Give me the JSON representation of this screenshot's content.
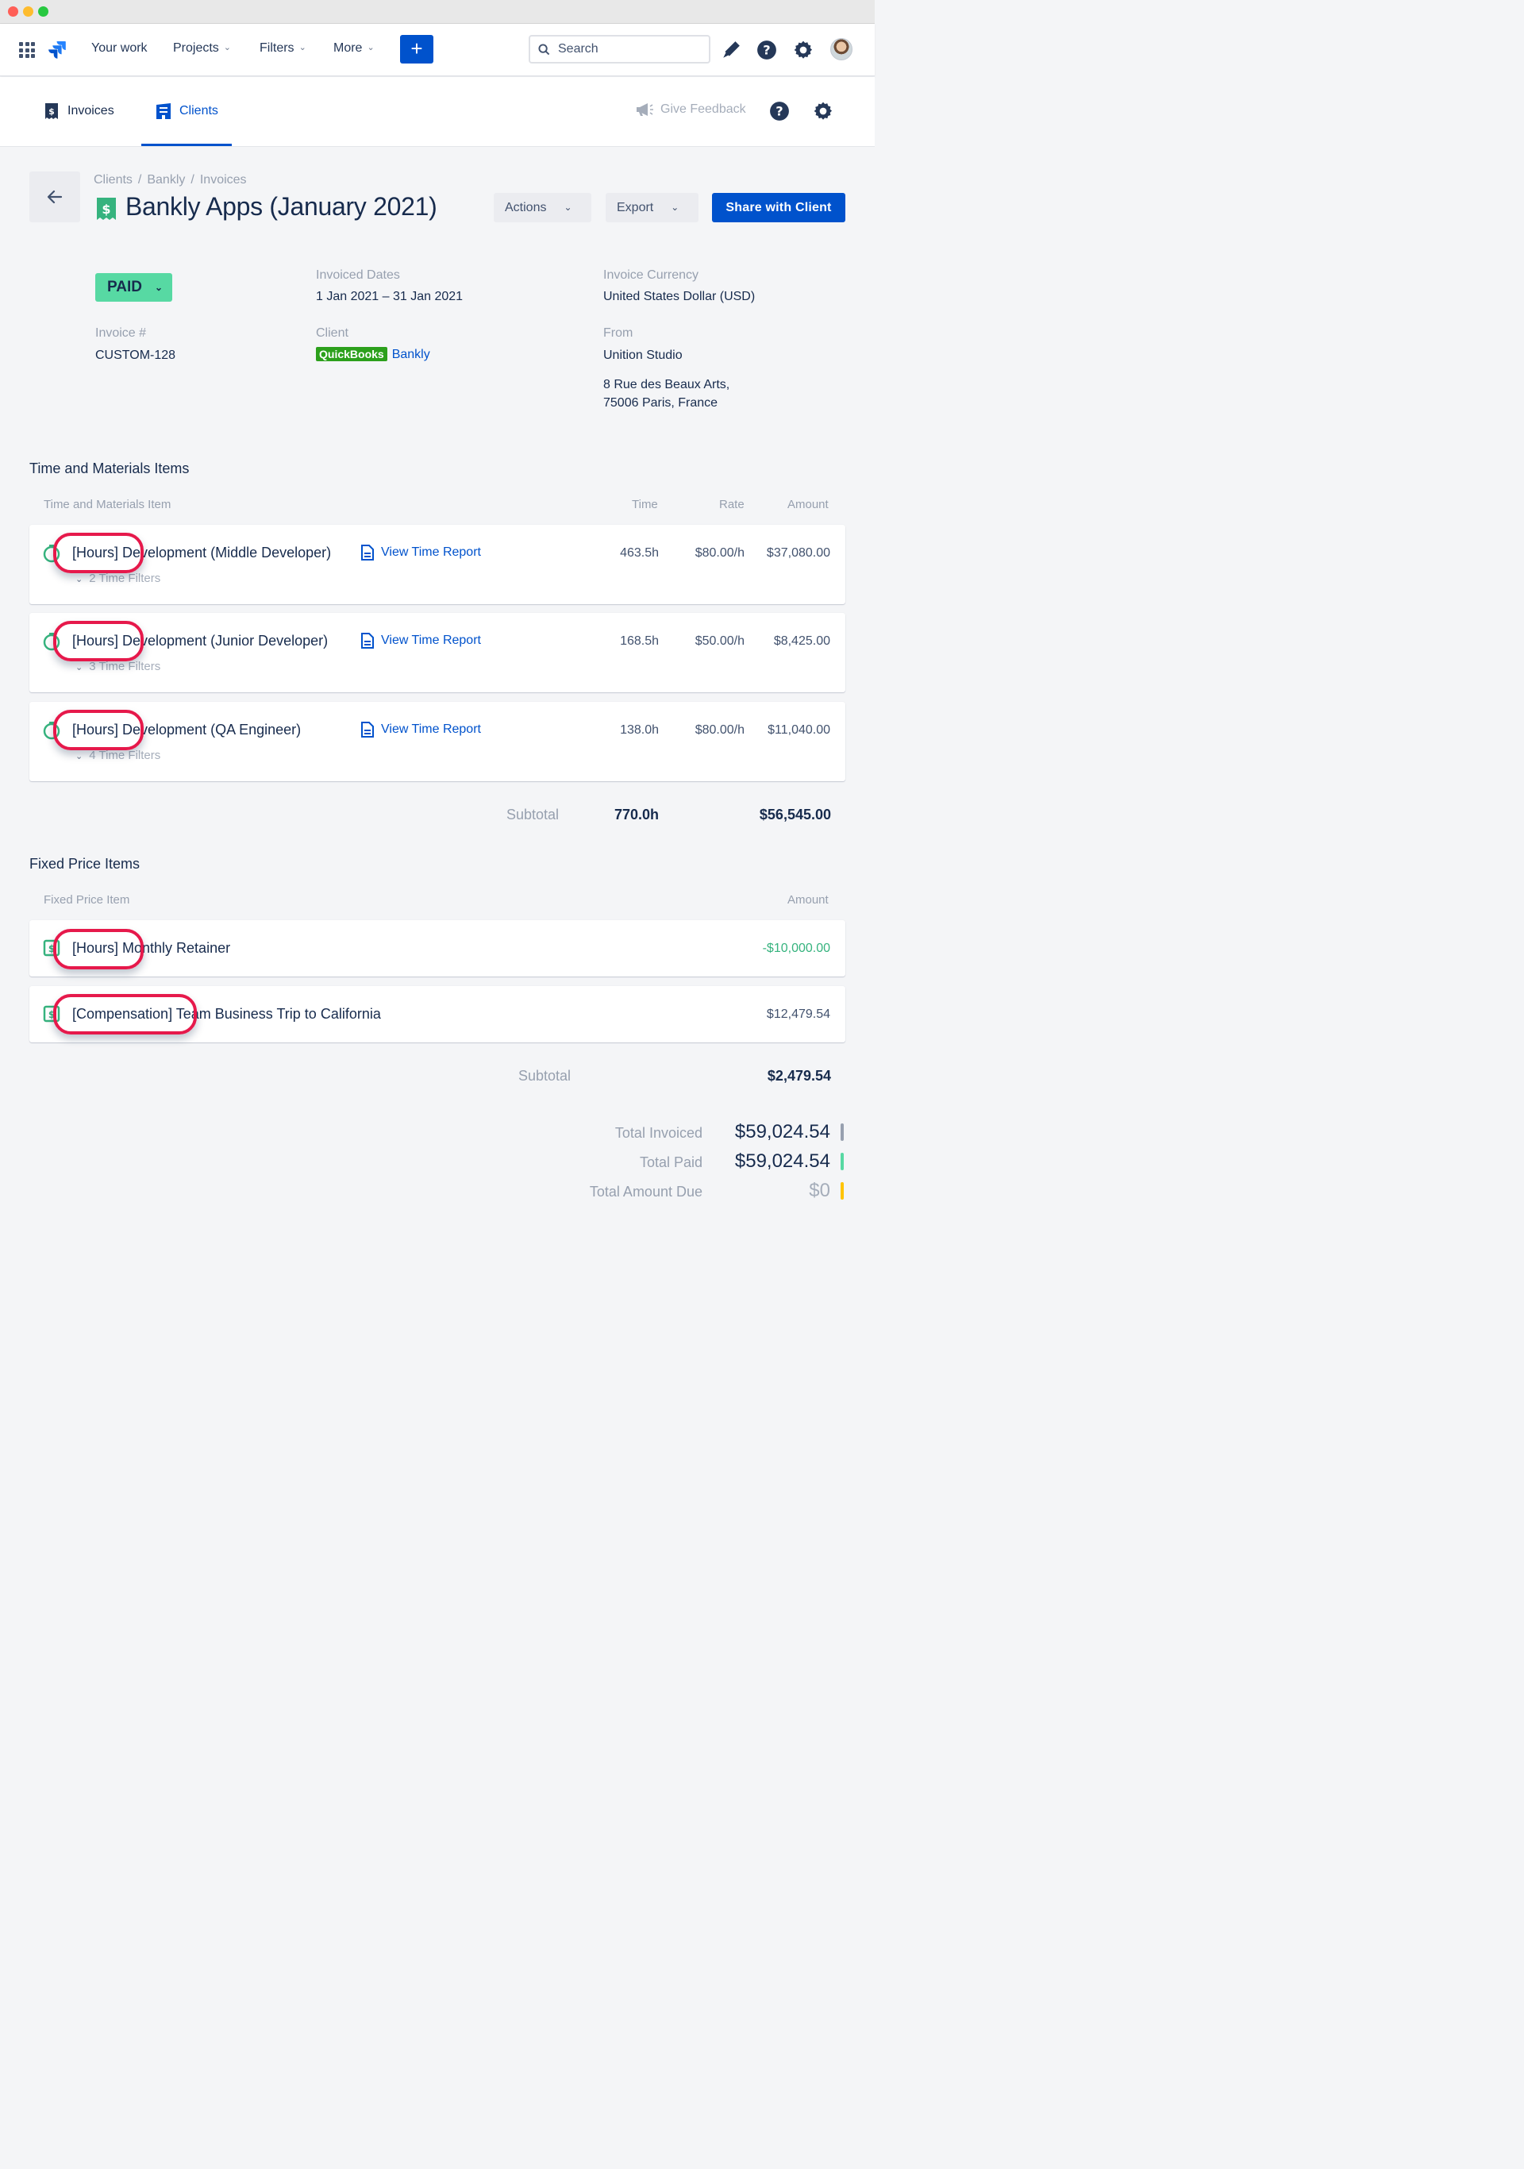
{
  "nav": {
    "your_work": "Your work",
    "projects": "Projects",
    "filters": "Filters",
    "more": "More",
    "create": "+",
    "search_placeholder": "Search"
  },
  "subnav": {
    "tabs": [
      {
        "label": "Invoices"
      },
      {
        "label": "Clients"
      }
    ],
    "feedback": "Give Feedback"
  },
  "breadcrumb": [
    "Clients",
    "Bankly",
    "Invoices"
  ],
  "breadcrumb_sep": "/",
  "page": {
    "title": "Bankly Apps (January 2021)",
    "actions": "Actions",
    "export": "Export",
    "share": "Share with Client"
  },
  "details": {
    "status": "PAID",
    "invoiced_dates_label": "Invoiced Dates",
    "invoiced_dates": "1 Jan 2021 – 31 Jan 2021",
    "currency_label": "Invoice Currency",
    "currency": "United States Dollar (USD)",
    "invoice_no_label": "Invoice #",
    "invoice_no": "CUSTOM-128",
    "client_label": "Client",
    "client_badge": "QuickBooks",
    "client": "Bankly",
    "from_label": "From",
    "from": "Unition Studio",
    "address_line1": "8 Rue des Beaux Arts,",
    "address_line2": "75006 Paris, France"
  },
  "tm": {
    "title": "Time and Materials Items",
    "headers": {
      "item": "Time and Materials Item",
      "time": "Time",
      "rate": "Rate",
      "amount": "Amount"
    },
    "report_label": "View Time Report",
    "rows": [
      {
        "name": "[Hours] Development (Middle Developer)",
        "filters": "2 Time Filters",
        "time": "463.5h",
        "rate": "$80.00/h",
        "amount": "$37,080.00"
      },
      {
        "name": "[Hours] Development (Junior Developer)",
        "filters": "3 Time Filters",
        "time": "168.5h",
        "rate": "$50.00/h",
        "amount": "$8,425.00"
      },
      {
        "name": "[Hours] Development (QA Engineer)",
        "filters": "4 Time Filters",
        "time": "138.0h",
        "rate": "$80.00/h",
        "amount": "$11,040.00"
      }
    ],
    "subtotal_label": "Subtotal",
    "subtotal_time": "770.0h",
    "subtotal_amount": "$56,545.00"
  },
  "fp": {
    "title": "Fixed Price Items",
    "headers": {
      "item": "Fixed Price Item",
      "amount": "Amount"
    },
    "rows": [
      {
        "name": "[Hours] Monthly Retainer",
        "amount": "-$10,000.00"
      },
      {
        "name": "[Compensation] Team Business Trip to California",
        "amount": "$12,479.54"
      }
    ],
    "subtotal_label": "Subtotal",
    "subtotal_amount": "$2,479.54"
  },
  "totals": {
    "invoiced_label": "Total Invoiced",
    "invoiced": "$59,024.54",
    "paid_label": "Total Paid",
    "paid": "$59,024.54",
    "due_label": "Total Amount Due",
    "due": "$0"
  },
  "colors": {
    "brand": "#0052cc",
    "paid": "#57d9a3",
    "highlight": "#e6194b",
    "negative": "#36b37e",
    "bar_invoiced": "#97a0af",
    "bar_paid": "#57d9a3",
    "bar_due": "#ffc400"
  },
  "icons": [
    "apps-grid-icon",
    "jira-logo",
    "search-icon",
    "notification-icon",
    "help-icon",
    "settings-icon",
    "invoice-icon",
    "client-building-icon",
    "megaphone-icon",
    "arrow-left-icon",
    "time-report-icon",
    "stopwatch-icon",
    "fixed-price-icon"
  ]
}
